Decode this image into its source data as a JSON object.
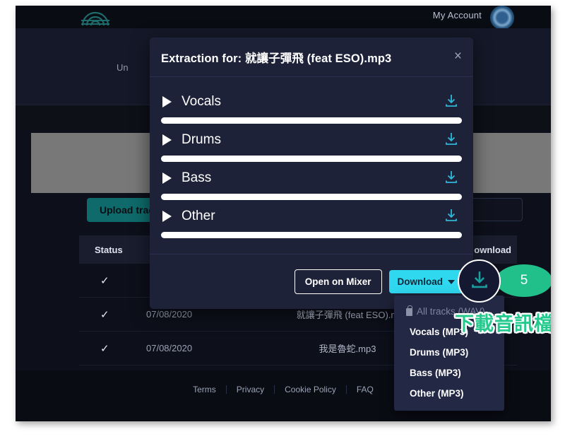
{
  "topnav": {
    "logo_icon": "waveform-logo-icon",
    "account_label": "My Account",
    "avatar_icon": "user-avatar"
  },
  "subbar": {
    "partial_text": "Un"
  },
  "actions": {
    "upload_label": "Upload track",
    "search_value": "",
    "search_placeholder": ""
  },
  "table": {
    "headers": {
      "status": "Status",
      "date": "",
      "name": "",
      "download": "ownload"
    },
    "rows": [
      {
        "status": "✓",
        "date": "",
        "name": "",
        "download": ""
      },
      {
        "status": "✓",
        "date": "07/08/2020",
        "name": "就讓子彈飛 (feat ESO).m",
        "download": ""
      },
      {
        "status": "✓",
        "date": "07/08/2020",
        "name": "我是魯蛇.mp3",
        "download": ""
      }
    ]
  },
  "footer": {
    "links": [
      "Terms",
      "Privacy",
      "Cookie Policy",
      "FAQ"
    ]
  },
  "modal": {
    "title": "Extraction for: 就讓子彈飛 (feat ESO).mp3",
    "close_label": "×",
    "stems": [
      {
        "label": "Vocals",
        "play_icon": "play-icon",
        "download_icon": "download-icon"
      },
      {
        "label": "Drums",
        "play_icon": "play-icon",
        "download_icon": "download-icon"
      },
      {
        "label": "Bass",
        "play_icon": "play-icon",
        "download_icon": "download-icon"
      },
      {
        "label": "Other",
        "play_icon": "play-icon",
        "download_icon": "download-icon"
      }
    ],
    "open_mixer_label": "Open on Mixer",
    "download_label": "Download"
  },
  "dropdown": {
    "items": [
      {
        "label": "All tracks (WAV)",
        "disabled": true,
        "icon": "lock-icon"
      },
      {
        "label": "Vocals (MP3)",
        "disabled": false
      },
      {
        "label": "Drums (MP3)",
        "disabled": false
      },
      {
        "label": "Bass (MP3)",
        "disabled": false
      },
      {
        "label": "Other (MP3)",
        "disabled": false
      }
    ]
  },
  "annotations": {
    "step_number": "5",
    "note_text": "下載音訊檔"
  },
  "colors": {
    "accent_cyan": "#2fd8ef",
    "accent_teal": "#0f6b6b",
    "annotation_green": "#21c08a",
    "modal_bg": "#1e2238",
    "page_bg": "#0d0f1a"
  }
}
